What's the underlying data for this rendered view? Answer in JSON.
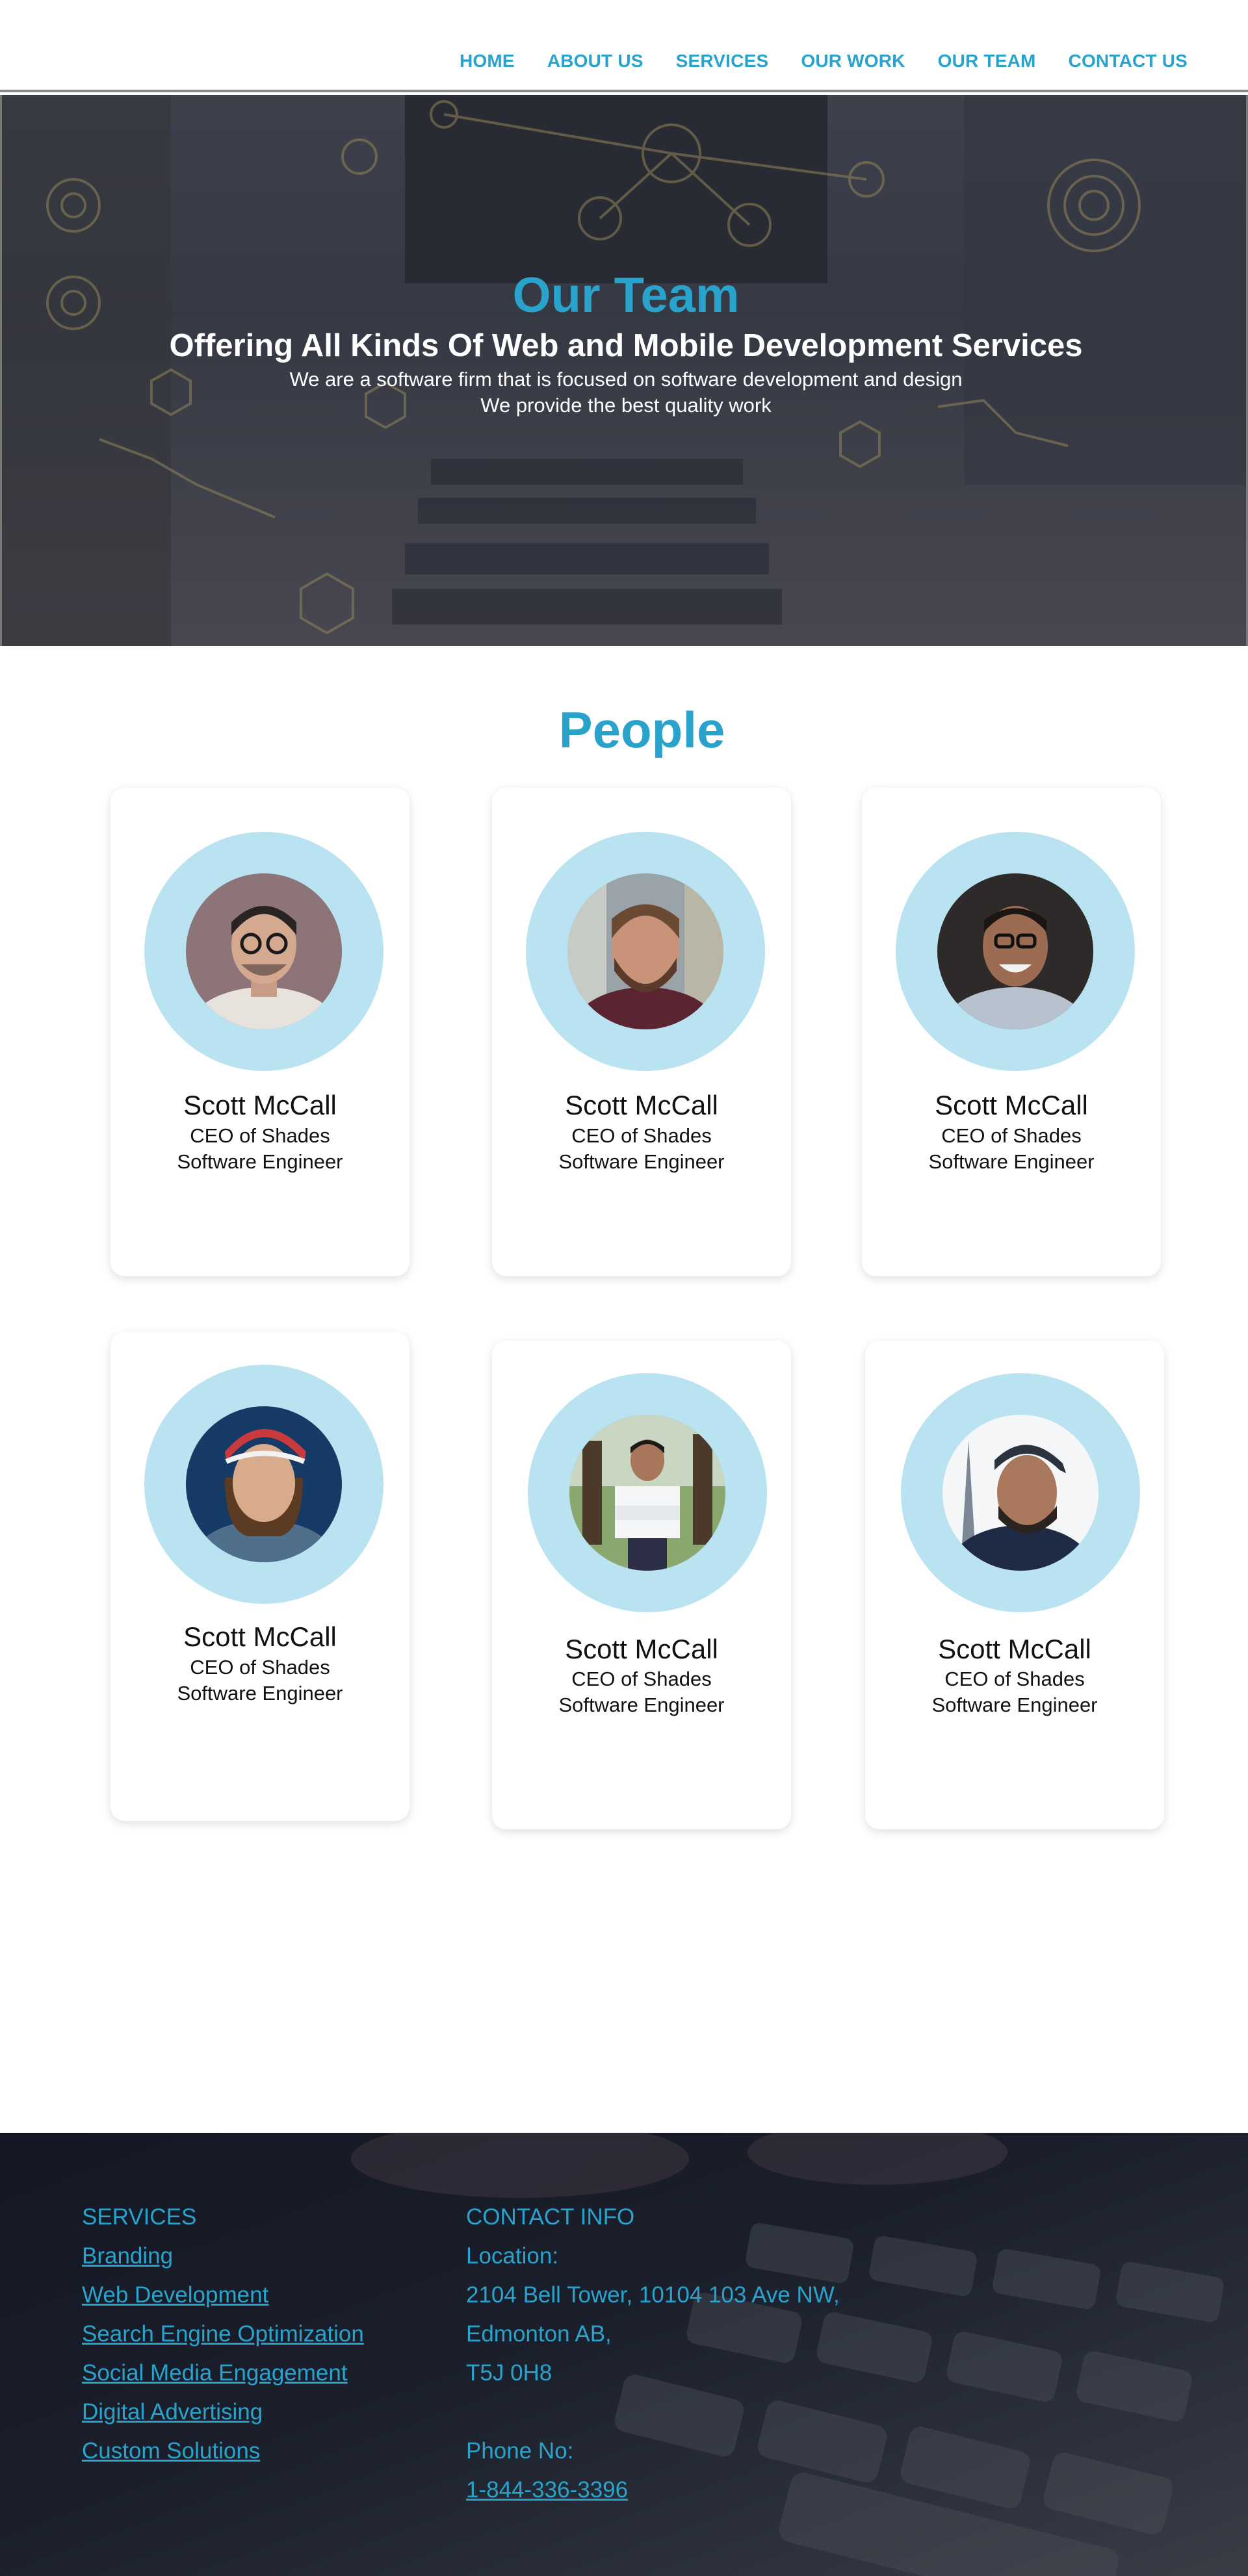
{
  "nav": {
    "items": [
      "HOME",
      "ABOUT US",
      "SERVICES",
      "OUR WORK",
      "OUR TEAM",
      "CONTACT US"
    ]
  },
  "hero": {
    "title": "Our Team",
    "subtitle": "Offering All Kinds Of Web and Mobile Development Services",
    "line1": "We are a software firm that is focused on software development and design",
    "line2": "We provide the best quality work"
  },
  "people": {
    "title": "People",
    "members": [
      {
        "name": "Scott McCall",
        "role1": "CEO of Shades",
        "role2": "Software Engineer"
      },
      {
        "name": "Scott McCall",
        "role1": "CEO of Shades",
        "role2": "Software Engineer"
      },
      {
        "name": "Scott McCall",
        "role1": "CEO of Shades",
        "role2": "Software Engineer"
      },
      {
        "name": "Scott McCall",
        "role1": "CEO of Shades",
        "role2": "Software Engineer"
      },
      {
        "name": "Scott McCall",
        "role1": "CEO of Shades",
        "role2": "Software Engineer"
      },
      {
        "name": "Scott McCall",
        "role1": "CEO of Shades",
        "role2": "Software Engineer"
      }
    ]
  },
  "footer": {
    "services": {
      "heading": "SERVICES",
      "items": [
        "Branding",
        "Web Development",
        "Search Engine Optimization",
        "Social Media Engagement",
        "Digital Advertising",
        "Custom Solutions"
      ]
    },
    "contact": {
      "heading": "CONTACT INFO",
      "location_label": "Location:",
      "address1": "2104 Bell Tower, 10104 103 Ave NW,",
      "address2": "Edmonton AB,",
      "address3": "T5J 0H8",
      "phone_label": "Phone No:",
      "phone": "1-844-336-3396"
    }
  },
  "colors": {
    "accent": "#2aa3cc",
    "ring": "#b9e3f0",
    "footer_bg": "#141824"
  }
}
